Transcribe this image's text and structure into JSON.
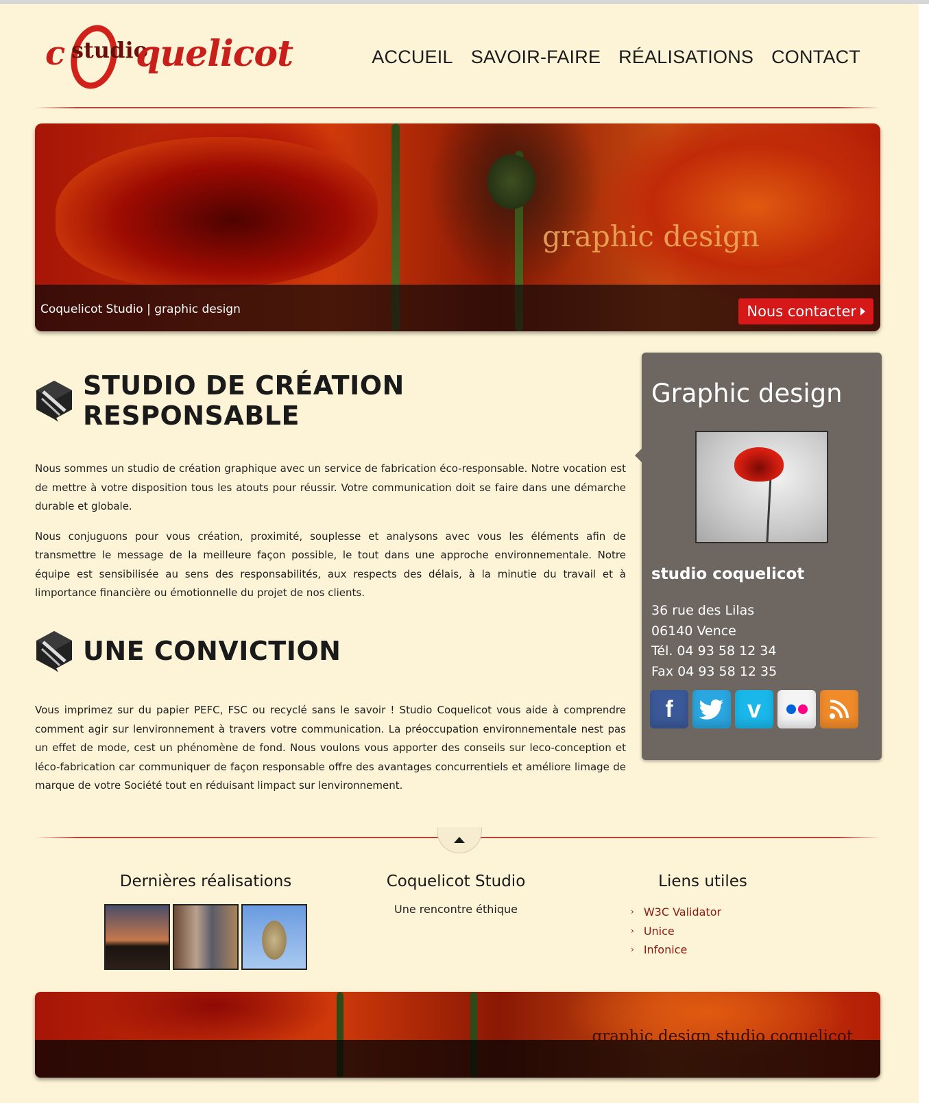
{
  "logo": {
    "c": "c",
    "studio": "studio",
    "rest": "quelicot"
  },
  "nav": [
    "ACCUEIL",
    "SAVOIR-FAIRE",
    "RÉALISATIONS",
    "CONTACT"
  ],
  "banner": {
    "tagline": "graphic design",
    "caption": "Coquelicot Studio | graphic design",
    "cta": "Nous contacter"
  },
  "sections": [
    {
      "title": "STUDIO DE CRÉATION RESPONSABLE",
      "paragraphs": [
        "Nous sommes un studio de création graphique avec un service de fabrication éco-responsable. Notre vocation est de mettre à votre disposition tous les atouts pour réussir. Votre communication doit se faire dans une démarche durable et globale.",
        "Nous conjuguons pour vous création, proximité, souplesse et analysons avec vous les éléments afin de transmettre le message de la meilleure façon possible, le tout dans une approche environnementale. Notre équipe est sensibilisée au sens des responsabilités, aux respects des délais, à la minutie du travail et à limportance financière ou émotionnelle du projet de nos clients."
      ]
    },
    {
      "title": "UNE CONVICTION",
      "paragraphs": [
        "Vous imprimez sur du papier PEFC, FSC ou recyclé sans le savoir ! Studio Coquelicot vous aide à comprendre comment agir sur lenvironnement à travers votre communication. La préoccupation environnementale nest pas un effet de mode, cest un phénomène de fond. Nous voulons vous apporter des conseils sur leco-conception et léco-fabrication car communiquer de façon responsable offre des avantages concurrentiels et améliore limage de marque de votre Société tout en réduisant limpact sur lenvironnement."
      ]
    }
  ],
  "sidebar": {
    "title": "Graphic design",
    "name": "studio coquelicot",
    "address": [
      "36 rue des Lilas",
      "06140 Vence",
      "Tél. 04 93 58 12 34",
      "Fax 04 93 58 12 35"
    ],
    "social": [
      "facebook-icon",
      "twitter-icon",
      "vimeo-icon",
      "flickr-icon",
      "rss-icon"
    ]
  },
  "footer": {
    "col1_title": "Dernières réalisations",
    "col2_title": "Coquelicot Studio",
    "col2_text": "Une rencontre éthique",
    "col3_title": "Liens utiles",
    "links": [
      "W3C Validator",
      "Unice",
      "Infonice"
    ],
    "banner_tag": "graphic design studio coquelicot"
  },
  "colors": {
    "background": "#fdf3d6",
    "accent_red": "#d71818",
    "sidebar": "#6d6661",
    "link": "#8a1a12"
  }
}
